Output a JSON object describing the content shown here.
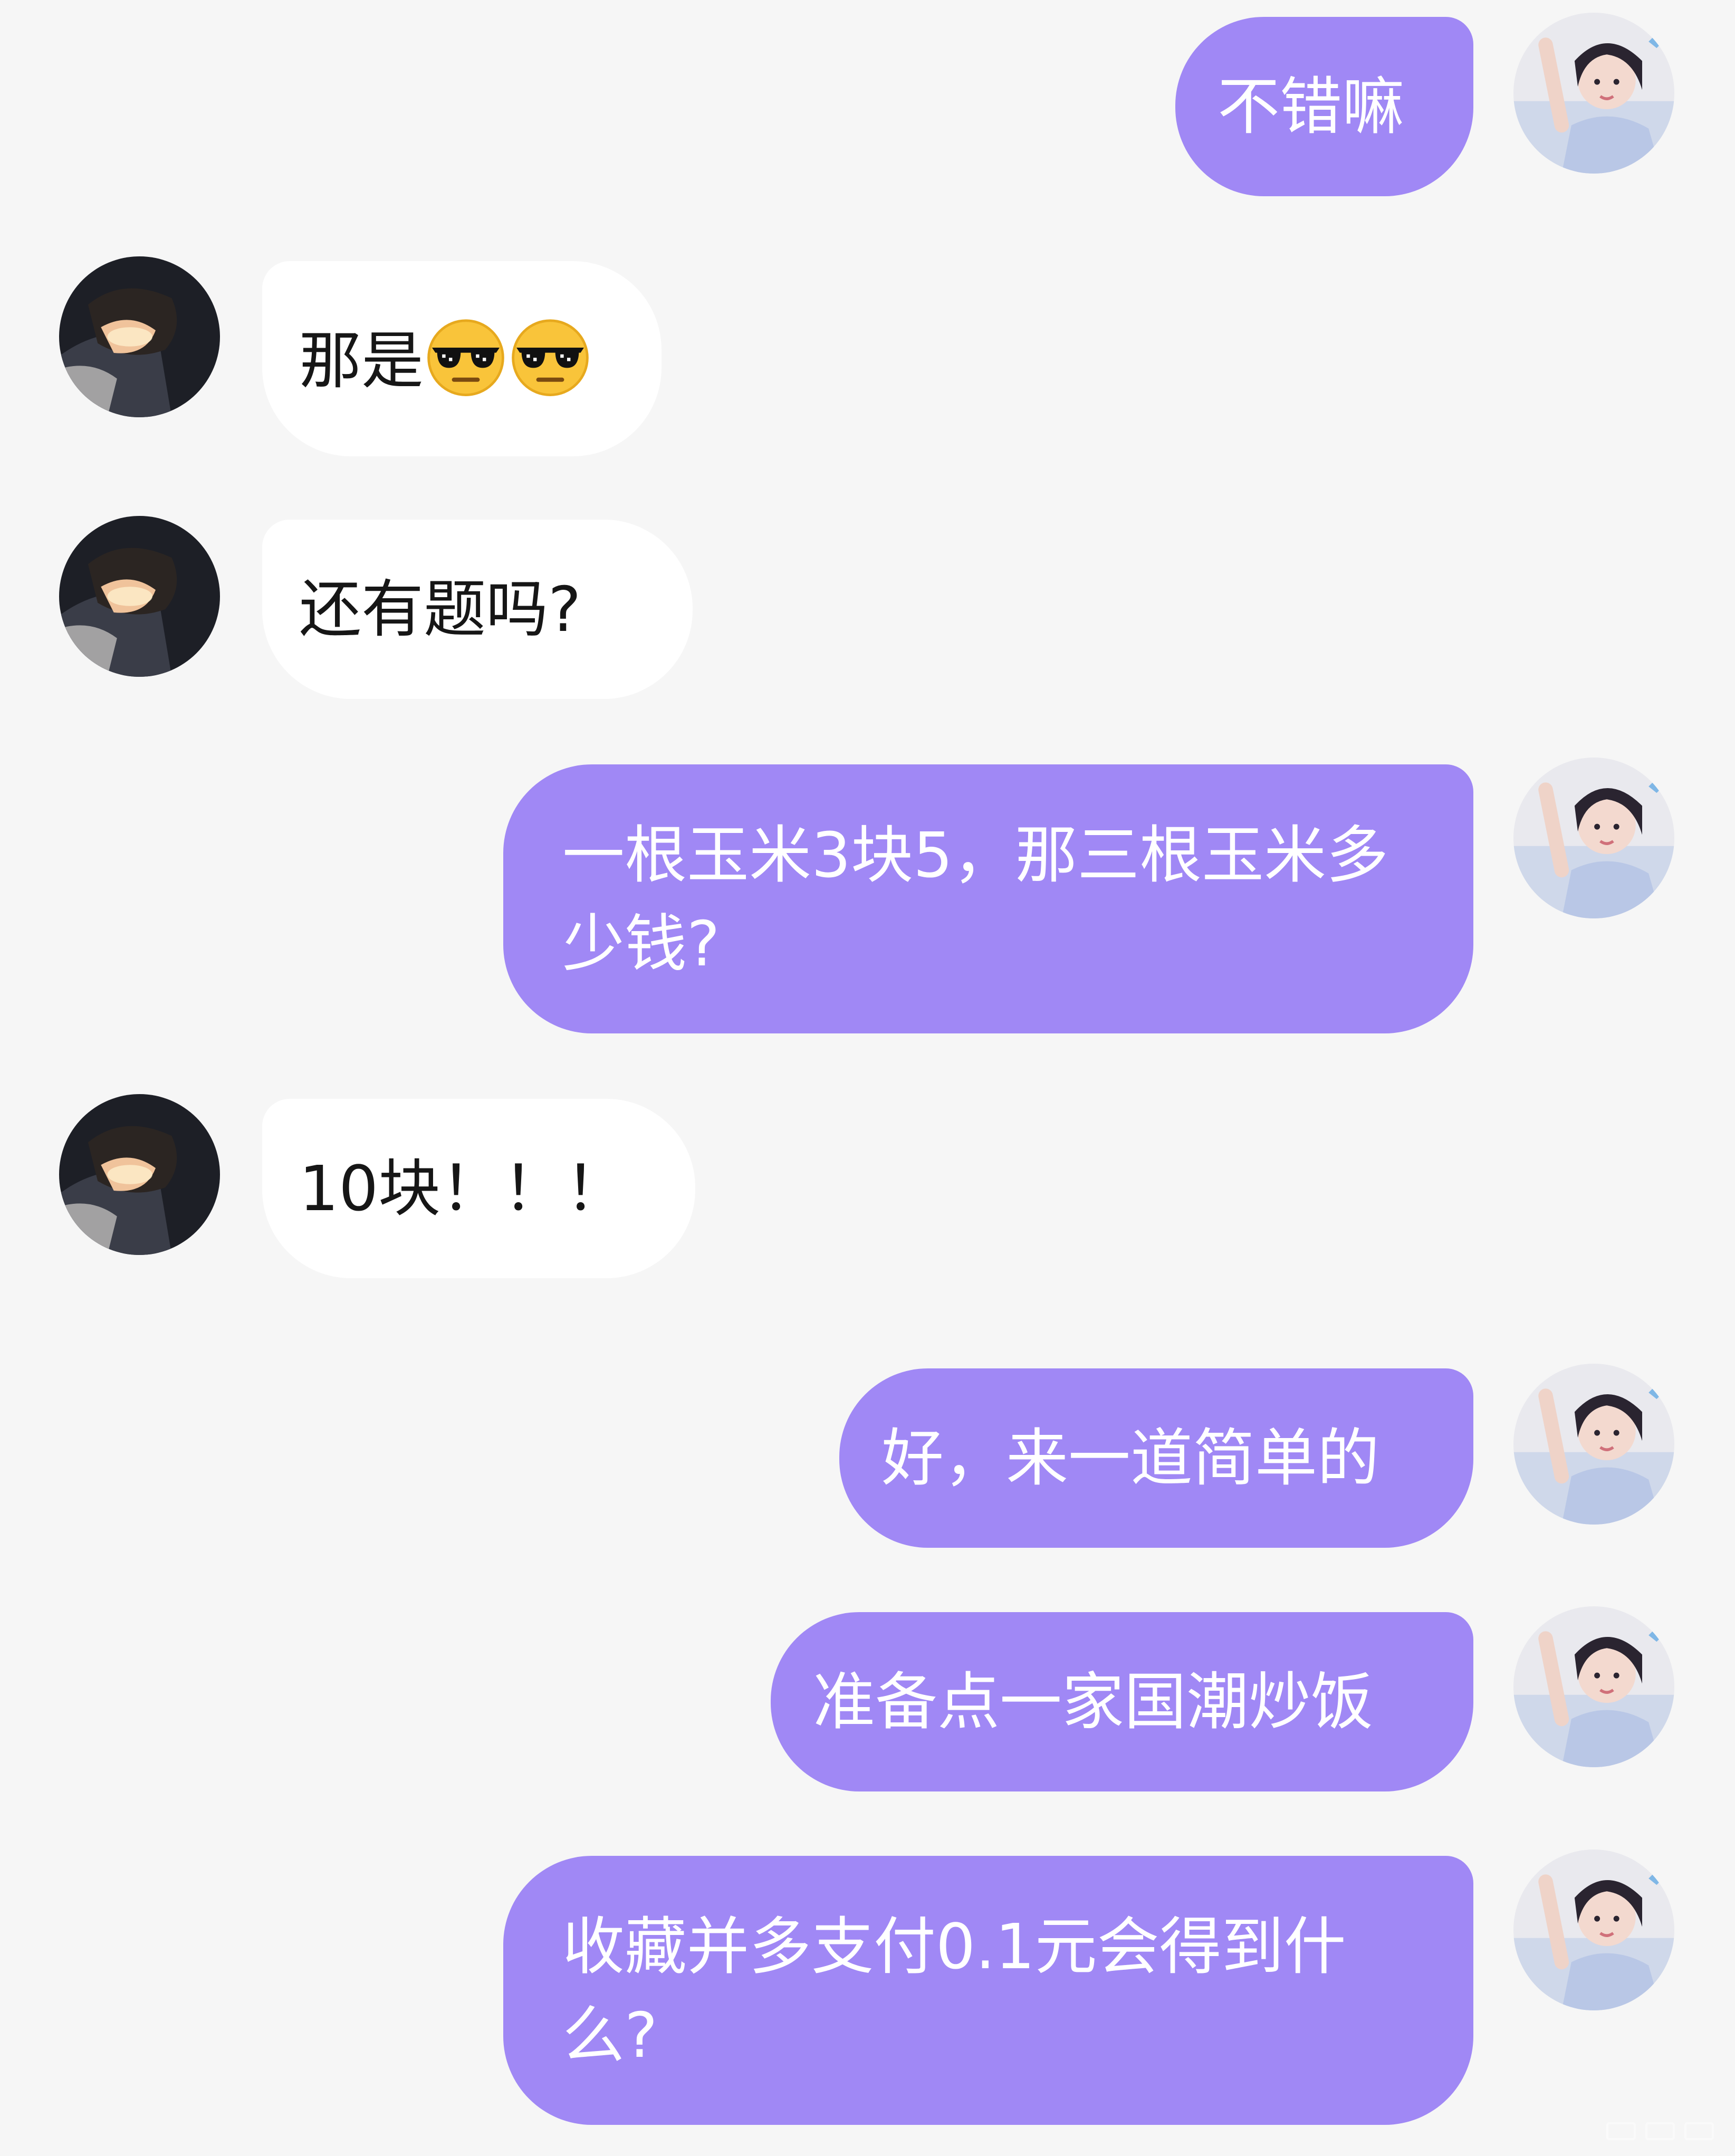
{
  "colors": {
    "background": "#f6f6f6",
    "outgoing_bubble": "#a088f5",
    "incoming_bubble": "#ffffff",
    "outgoing_text": "#ffffff",
    "incoming_text": "#161616"
  },
  "messages": [
    {
      "side": "out",
      "text": "不错嘛"
    },
    {
      "side": "in",
      "text": "那是",
      "emoji": [
        "sunglasses-face",
        "sunglasses-face"
      ]
    },
    {
      "side": "in",
      "text": "还有题吗?"
    },
    {
      "side": "out",
      "text": "一根玉米3块5，那三根玉米多少钱?"
    },
    {
      "side": "in",
      "text": "10块！！！"
    },
    {
      "side": "out",
      "text": "好，来一道简单的"
    },
    {
      "side": "out",
      "text": "准备点一家国潮炒饭"
    },
    {
      "side": "out",
      "text": "收藏并多支付0.1元会得到什么?"
    }
  ]
}
